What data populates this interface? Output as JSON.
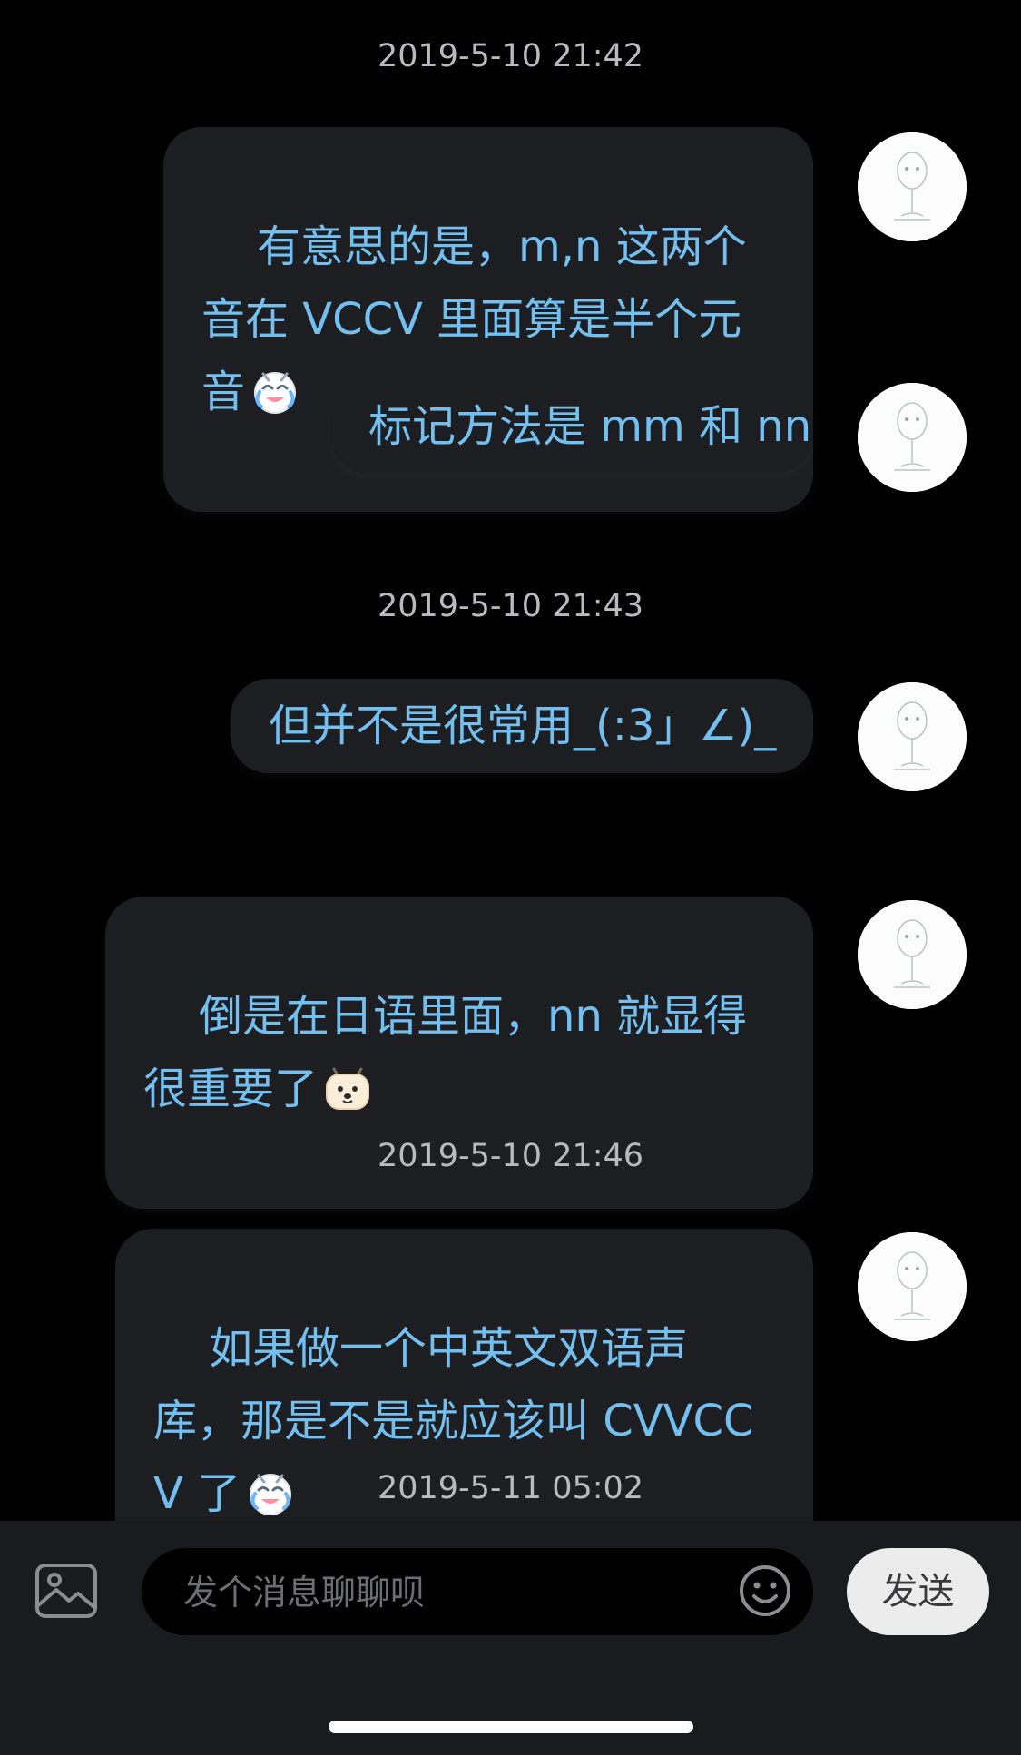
{
  "conversation": {
    "timestamps": [
      "2019-5-10 21:42",
      "2019-5-10 21:43",
      "2019-5-10 21:46",
      "2019-5-11 05:02"
    ],
    "messages": [
      {
        "text": "有意思的是，m,n 这两个音在 VCCV 里面算是半个元音",
        "emoji": "crying-laughing-emoji",
        "sender": "self"
      },
      {
        "text": "标记方法是 mm 和 nn",
        "sender": "self"
      },
      {
        "text": "但并不是很常用_(:3」∠)_",
        "sender": "self"
      },
      {
        "text": "倒是在日语里面，nn 就显得很重要了",
        "emoji": "dog-face-emoji",
        "sender": "self"
      },
      {
        "text": "如果做一个中英文双语声库，那是不是就应该叫 CVVCCV 了",
        "emoji": "crying-laughing-emoji",
        "sender": "self"
      }
    ]
  },
  "composer": {
    "placeholder": "发个消息聊聊呗",
    "value": "",
    "send_label": "发送",
    "image_icon": "image-icon",
    "emoji_icon": "smiley-face-icon"
  },
  "colors": {
    "background": "#000000",
    "bubble": "#1d1e22",
    "message_text": "#72bff0",
    "timestamp_text": "#b9b9be",
    "composer_bar": "#1a1b1f",
    "send_button": "#ececec"
  }
}
